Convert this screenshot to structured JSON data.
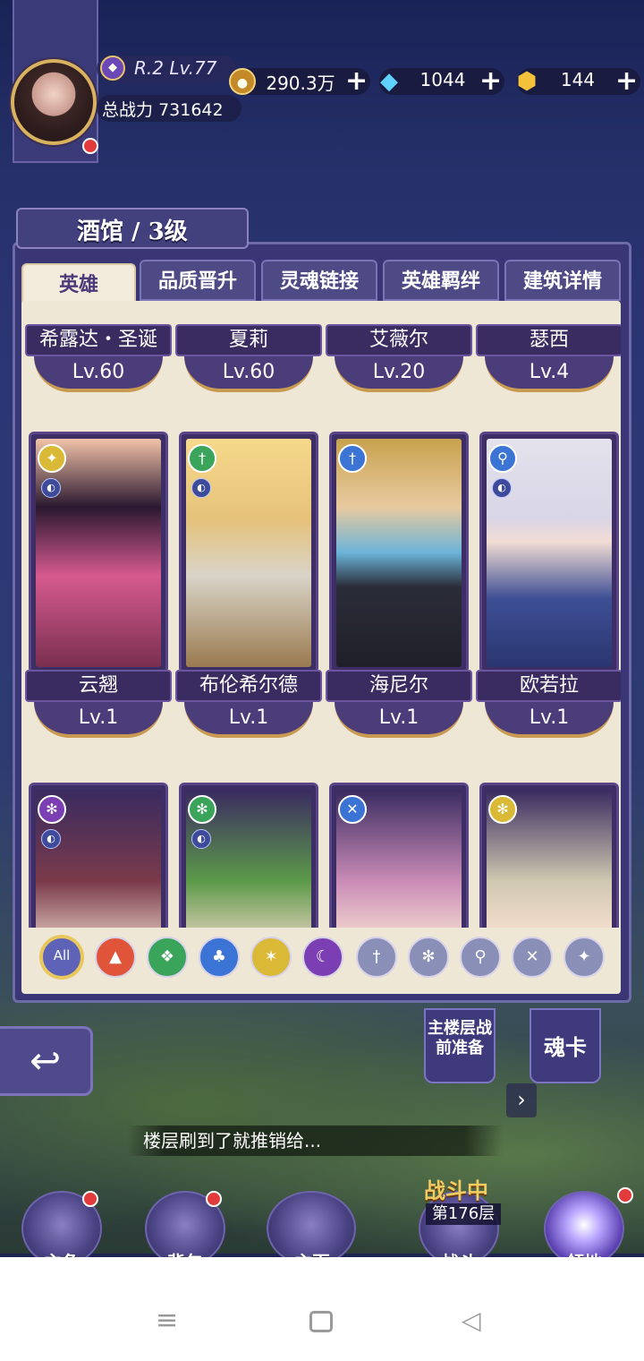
{
  "player": {
    "rank_level": "R.2 Lv.77",
    "power_label": "总战力",
    "power_value": "731642"
  },
  "resources": [
    {
      "name": "gold",
      "icon": "gold-coin-icon",
      "value": "290.3万"
    },
    {
      "name": "diamond",
      "icon": "blue-crystal-icon",
      "value": "1044"
    },
    {
      "name": "gem",
      "icon": "gold-gem-icon",
      "value": "144"
    }
  ],
  "plus_label": "+",
  "panel": {
    "title": "酒馆 / 3级",
    "tabs": [
      "英雄",
      "品质晋升",
      "灵魂链接",
      "英雄羁绊",
      "建筑详情"
    ],
    "active_tab": 0
  },
  "heroes": [
    {
      "name": "希露达・圣诞",
      "level": "Lv.60"
    },
    {
      "name": "夏莉",
      "level": "Lv.60"
    },
    {
      "name": "艾薇尔",
      "level": "Lv.20"
    },
    {
      "name": "瑟西",
      "level": "Lv.4"
    },
    {
      "name": "云翘",
      "level": "Lv.1",
      "element": "wing-icon",
      "art": "#d65a8f"
    },
    {
      "name": "布伦希尔德",
      "level": "Lv.1",
      "element": "dagger-icon",
      "art": "#c79a4d"
    },
    {
      "name": "海尼尔",
      "level": "Lv.1",
      "element": "dagger-icon",
      "art": "#3c4158"
    },
    {
      "name": "欧若拉",
      "level": "Lv.1",
      "element": "staff-icon",
      "art": "#4a5ba0"
    },
    {
      "name": "",
      "level": "",
      "element": "shuriken-icon",
      "art": "#7a3a4a"
    },
    {
      "name": "",
      "level": "",
      "element": "shuriken-icon",
      "art": "#5c9a4a"
    },
    {
      "name": "",
      "level": "",
      "element": "crossed-bow-icon",
      "art": "#c98bb6"
    },
    {
      "name": "",
      "level": "",
      "element": "shuriken-icon",
      "art": "#8a6a4a"
    }
  ],
  "filters": [
    {
      "label": "All",
      "icon": "all-icon",
      "color": "#5e63b8"
    },
    {
      "label": "",
      "icon": "fire-icon",
      "color": "#e0553a"
    },
    {
      "label": "",
      "icon": "leaf-icon",
      "color": "#3aa55a"
    },
    {
      "label": "",
      "icon": "water-icon",
      "color": "#3b74d4"
    },
    {
      "label": "",
      "icon": "light-icon",
      "color": "#d9b935"
    },
    {
      "label": "",
      "icon": "dark-icon",
      "color": "#7b3fb3"
    },
    {
      "label": "",
      "icon": "dagger-icon",
      "color": "#8a8fb8"
    },
    {
      "label": "",
      "icon": "shuriken-icon",
      "color": "#8a8fb8"
    },
    {
      "label": "",
      "icon": "staff-icon",
      "color": "#8a8fb8"
    },
    {
      "label": "",
      "icon": "crossed-bow-icon",
      "color": "#8a8fb8"
    },
    {
      "label": "",
      "icon": "wing-icon",
      "color": "#8a8fb8"
    }
  ],
  "side_buttons": {
    "prepare": "主楼层战前准备",
    "soul_card": "魂卡"
  },
  "chat_message": "楼层刷到了就推销给...",
  "nav": [
    {
      "label": "主角",
      "icon": "hero-icon",
      "badge": true
    },
    {
      "label": "背包",
      "icon": "backpack-icon",
      "badge": true
    },
    {
      "label": "主页",
      "icon": "book-icon",
      "badge": false
    },
    {
      "label": "战斗",
      "icon": "swords-icon",
      "badge": false
    },
    {
      "label": "领地",
      "icon": "castle-icon",
      "badge": true
    }
  ],
  "battle": {
    "status": "战斗中",
    "floor": "第176层"
  },
  "system_nav": [
    "menu-icon",
    "home-icon",
    "back-icon"
  ]
}
